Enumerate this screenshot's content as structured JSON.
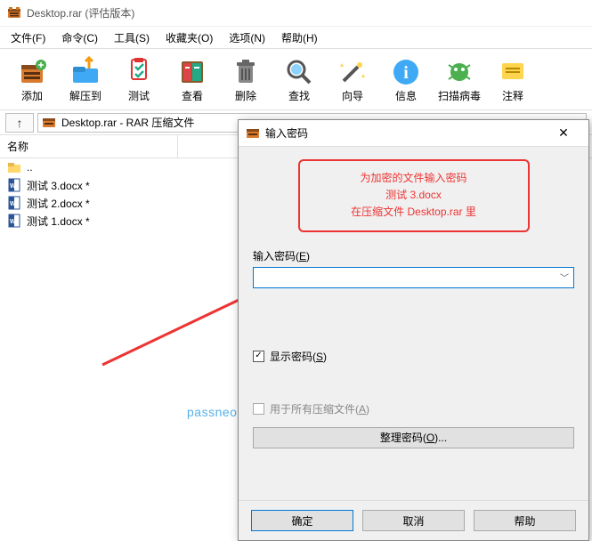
{
  "titlebar": {
    "title": "Desktop.rar (评估版本)"
  },
  "menu": {
    "file": "文件(F)",
    "commands": "命令(C)",
    "tools": "工具(S)",
    "favorites": "收藏夹(O)",
    "options": "选项(N)",
    "help": "帮助(H)"
  },
  "toolbar": {
    "add": "添加",
    "extract": "解压到",
    "test": "测试",
    "view": "查看",
    "delete": "删除",
    "find": "查找",
    "wizard": "向导",
    "info": "信息",
    "scan": "扫描病毒",
    "comment": "注释"
  },
  "addressbar": {
    "path": "Desktop.rar - RAR 压缩文件"
  },
  "list": {
    "col_name": "名称",
    "rows": [
      {
        "name": "..",
        "type": "folder"
      },
      {
        "name": "测试 3.docx *",
        "type": "docx"
      },
      {
        "name": "测试 2.docx *",
        "type": "docx"
      },
      {
        "name": "测试 1.docx *",
        "type": "docx"
      }
    ]
  },
  "dialog": {
    "title": "输入密码",
    "prompt_line1": "为加密的文件输入密码",
    "prompt_line2": "测试 3.docx",
    "prompt_line3": "在压缩文件 Desktop.rar 里",
    "field_label_prefix": "输入密码(",
    "field_label_u": "E",
    "field_label_suffix": ")",
    "password_value": "",
    "show_password_prefix": "显示密码(",
    "show_password_u": "S",
    "show_password_suffix": ")",
    "show_password_checked": true,
    "apply_all_prefix": "用于所有压缩文件(",
    "apply_all_u": "A",
    "apply_all_suffix": ")",
    "organize_prefix": "整理密码(",
    "organize_u": "O",
    "organize_suffix": ")...",
    "ok": "确定",
    "cancel": "取消",
    "help": "帮助"
  },
  "watermark": "passneo.cn"
}
